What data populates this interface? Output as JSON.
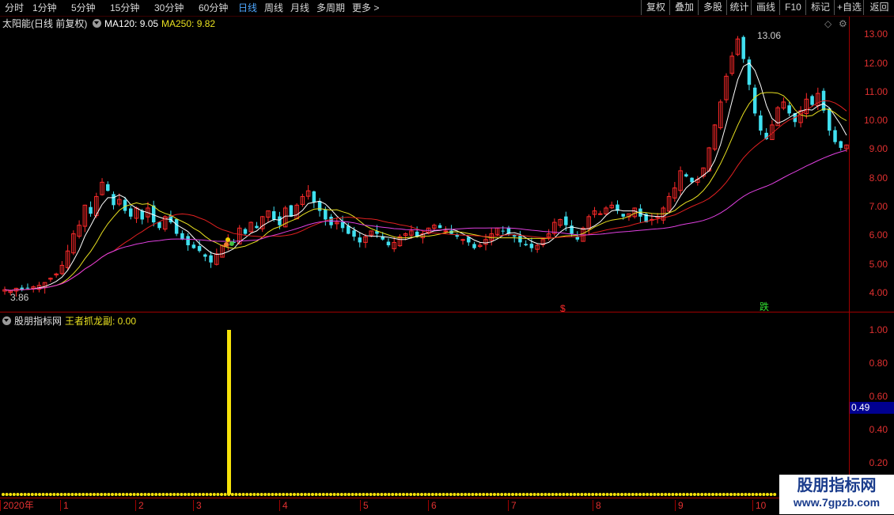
{
  "toolbar": {
    "periods": [
      "分时",
      "1分钟",
      "5分钟",
      "15分钟",
      "30分钟",
      "60分钟",
      "日线",
      "周线",
      "月线",
      "多周期",
      "更多 >"
    ],
    "active_period": "日线",
    "right_buttons": [
      "复权",
      "叠加",
      "多股",
      "统计",
      "画线",
      "F10",
      "标记",
      "+自选",
      "返回"
    ]
  },
  "main_header": {
    "stock": "太阳能(日线 前复权)",
    "ma120_label": "MA120: 9.05",
    "ma250_label": "MA250: 9.82"
  },
  "sub_header": {
    "site": "股朋指标网",
    "indicator_label": "王者抓龙副: 0.00"
  },
  "colors": {
    "up": "#ff2a2a",
    "down": "#40e0f0",
    "ma_white": "#ffffff",
    "ma_yellow": "#e8e020",
    "ma_red": "#e02020",
    "ma_magenta": "#e040e0",
    "axis": "#a00000",
    "axis_text": "#e03030",
    "indicator": "#f5e20a",
    "cursor_box": "#000090"
  },
  "main_axis_ticks": [
    "13.00",
    "12.00",
    "11.00",
    "10.00",
    "9.00",
    "8.00",
    "7.00",
    "6.00",
    "5.00",
    "4.00"
  ],
  "sub_axis_ticks": [
    "1.00",
    "0.80",
    "0.60",
    "0.40",
    "0.20"
  ],
  "cursor_value": "0.49",
  "annotations": {
    "high_label": "13.06",
    "low_label": "3.86",
    "mark_s": "$",
    "mark_die": "跌"
  },
  "dates": [
    "2020年",
    "1",
    "2",
    "3",
    "4",
    "5",
    "6",
    "7",
    "8",
    "9",
    "10"
  ],
  "watermark": {
    "line1": "股朋指标网",
    "line2": "www.7gpzb.com"
  },
  "chart_data": {
    "type": "candlestick",
    "ylim": [
      3.5,
      13.5
    ],
    "sub_ylim": [
      0,
      1.05
    ],
    "high": 13.06,
    "low": 3.86,
    "ma120": 9.05,
    "ma250": 9.82,
    "indicator_value": 0.0,
    "indicator_spike": {
      "date_index": 84,
      "value": 1.0
    },
    "closes": [
      4.05,
      4.0,
      4.1,
      4.05,
      4.1,
      4.15,
      4.2,
      4.3,
      4.45,
      4.6,
      4.9,
      5.4,
      6.0,
      6.3,
      7.0,
      6.7,
      7.3,
      7.8,
      7.5,
      7.0,
      7.2,
      6.8,
      6.6,
      6.9,
      6.5,
      6.9,
      6.4,
      6.2,
      6.6,
      6.4,
      6.0,
      5.8,
      5.6,
      5.5,
      5.4,
      5.2,
      5.0,
      5.3,
      5.6,
      5.8,
      5.7,
      6.2,
      6.0,
      6.4,
      6.2,
      6.6,
      6.8,
      6.5,
      6.3,
      6.9,
      6.6,
      7.0,
      7.3,
      7.5,
      7.1,
      6.8,
      6.5,
      6.3,
      6.4,
      6.2,
      6.0,
      5.9,
      5.7,
      5.9,
      6.1,
      6.0,
      5.8,
      5.6,
      5.7,
      5.9,
      6.0,
      6.1,
      5.9,
      6.0,
      6.2,
      6.3,
      6.2,
      6.1,
      6.0,
      5.9,
      5.8,
      5.7,
      5.5,
      5.6,
      5.8,
      6.0,
      6.2,
      6.1,
      6.0,
      5.9,
      5.7,
      5.6,
      5.5,
      5.6,
      5.8,
      6.0,
      6.4,
      6.5,
      6.3,
      6.0,
      5.8,
      6.2,
      6.6,
      6.8,
      6.7,
      6.9,
      7.0,
      6.8,
      6.6,
      6.7,
      6.9,
      6.6,
      6.4,
      6.5,
      6.6,
      6.9,
      7.3,
      7.6,
      8.2,
      8.0,
      7.8,
      7.9,
      8.3,
      9.0,
      9.8,
      10.6,
      11.5,
      12.2,
      12.8,
      12.1,
      11.2,
      10.2,
      9.6,
      9.3,
      9.8,
      10.4,
      10.6,
      10.2,
      9.9,
      10.3,
      10.7,
      10.5,
      10.9,
      10.3,
      9.6,
      9.2,
      9.0,
      9.1
    ],
    "mark_s_index": 205,
    "mark_die_index": 281
  }
}
